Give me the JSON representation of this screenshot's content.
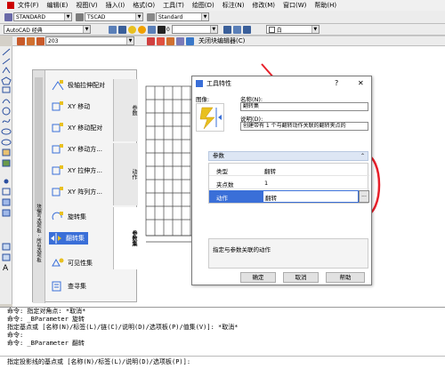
{
  "menubar": {
    "items": [
      "文件(F)",
      "编辑(E)",
      "视图(V)",
      "插入(I)",
      "格式(O)",
      "工具(T)",
      "绘图(D)",
      "标注(N)",
      "修改(M)",
      "窗口(W)",
      "帮助(H)"
    ]
  },
  "toolbar1": {
    "style1": "STANDARD",
    "style2": "TSCAD",
    "style3": "Standard"
  },
  "toolbar2": {
    "workspace": "AutoCAD 经典",
    "layer": "0",
    "color": "白"
  },
  "block_toolbar": {
    "block_name": "203",
    "close_label": "关闭块编辑器(C)"
  },
  "palette": {
    "items": [
      "极轴拉伸配对",
      "XY 移动",
      "XY 移动配对",
      "XY 移动方...",
      "XY 拉伸方...",
      "XY 阵列方...",
      "旋转集",
      "翻转集",
      "可见性集",
      "查寻集"
    ],
    "tabs": [
      "参数",
      "动作",
      "参数集"
    ],
    "side_label": "块编写选项板 - 所有选项板"
  },
  "dialog": {
    "title": "工具特性",
    "help": "?",
    "close": "✕",
    "image_label": "图像:",
    "name_label": "名称(N):",
    "name_value": "翻转集",
    "desc_label": "说明(D):",
    "desc_value": "创建带有 1 个与翻转动作关联的翻转夹点的",
    "section_title": "参数",
    "props": [
      {
        "label": "类型",
        "value": "翻转"
      },
      {
        "label": "夹点数",
        "value": "1"
      },
      {
        "label": "动作",
        "value": "翻转"
      }
    ],
    "ellipsis": "...",
    "hint": "指定与参数关联的动作",
    "buttons": {
      "ok": "确定",
      "cancel": "取消",
      "help": "帮助"
    }
  },
  "command": {
    "lines": [
      "命令: 指定对角点: *取消*",
      "命令: _BParameter 旋转",
      "指定基点或 [名称(N)/标签(L)/链(C)/说明(D)/选项板(P)/值集(V)]: *取消*",
      "命令:",
      "命令: _BParameter 翻转",
      "",
      "指定投影线的基点或 [名称(N)/标签(L)/说明(D)/选项板(P)]:"
    ]
  },
  "colors": {
    "annotation": "#e8202a",
    "selection": "#3a6fd8"
  }
}
